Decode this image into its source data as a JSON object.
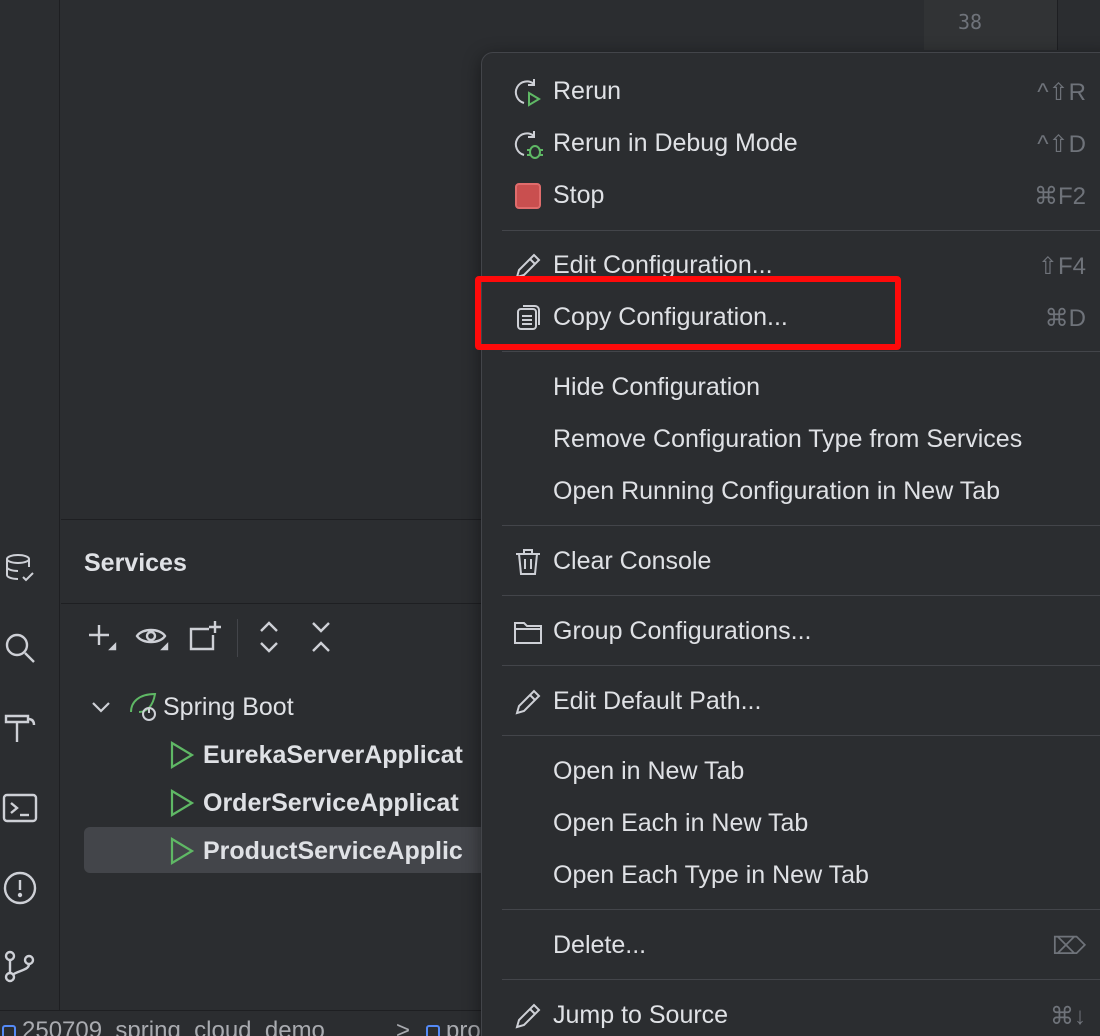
{
  "editor": {
    "line_number": "38"
  },
  "services": {
    "title": "Services",
    "tree": {
      "group_label": "Spring Boot",
      "items": [
        {
          "label": "EurekaServerApplicat"
        },
        {
          "label": "OrderServiceApplicat"
        },
        {
          "label": "ProductServiceApplic"
        }
      ]
    }
  },
  "statusbar": {
    "crumb1": "250709_spring_cloud_demo",
    "chevron": ">",
    "crumb2": "pro"
  },
  "menu": {
    "items": [
      {
        "label": "Rerun",
        "shortcut": "^⇧R",
        "icon": "rerun-icon"
      },
      {
        "label": "Rerun in Debug Mode",
        "shortcut": "^⇧D",
        "icon": "rerun-debug-icon"
      },
      {
        "label": "Stop",
        "shortcut": "⌘F2",
        "icon": "stop-icon"
      },
      {
        "label": "Edit Configuration...",
        "shortcut": "⇧F4",
        "icon": "pencil-icon"
      },
      {
        "label": "Copy Configuration...",
        "shortcut": "⌘D",
        "icon": "copy-icon"
      },
      {
        "label": "Hide Configuration",
        "shortcut": ""
      },
      {
        "label": "Remove Configuration Type from Services",
        "shortcut": ""
      },
      {
        "label": "Open Running Configuration in New Tab",
        "shortcut": ""
      },
      {
        "label": "Clear Console",
        "shortcut": "",
        "icon": "trash-icon"
      },
      {
        "label": "Group Configurations...",
        "shortcut": "",
        "icon": "folder-icon"
      },
      {
        "label": "Edit Default Path...",
        "shortcut": "",
        "icon": "pencil-icon"
      },
      {
        "label": "Open in New Tab",
        "shortcut": ""
      },
      {
        "label": "Open Each in New Tab",
        "shortcut": ""
      },
      {
        "label": "Open Each Type in New Tab",
        "shortcut": ""
      },
      {
        "label": "Delete...",
        "shortcut": "⌦"
      },
      {
        "label": "Jump to Source",
        "shortcut": "⌘↓",
        "icon": "pencil-icon"
      }
    ]
  },
  "colors": {
    "highlight": "#ff0a0a",
    "run_green": "#5fb865",
    "stop_red": "#c94f4f"
  }
}
